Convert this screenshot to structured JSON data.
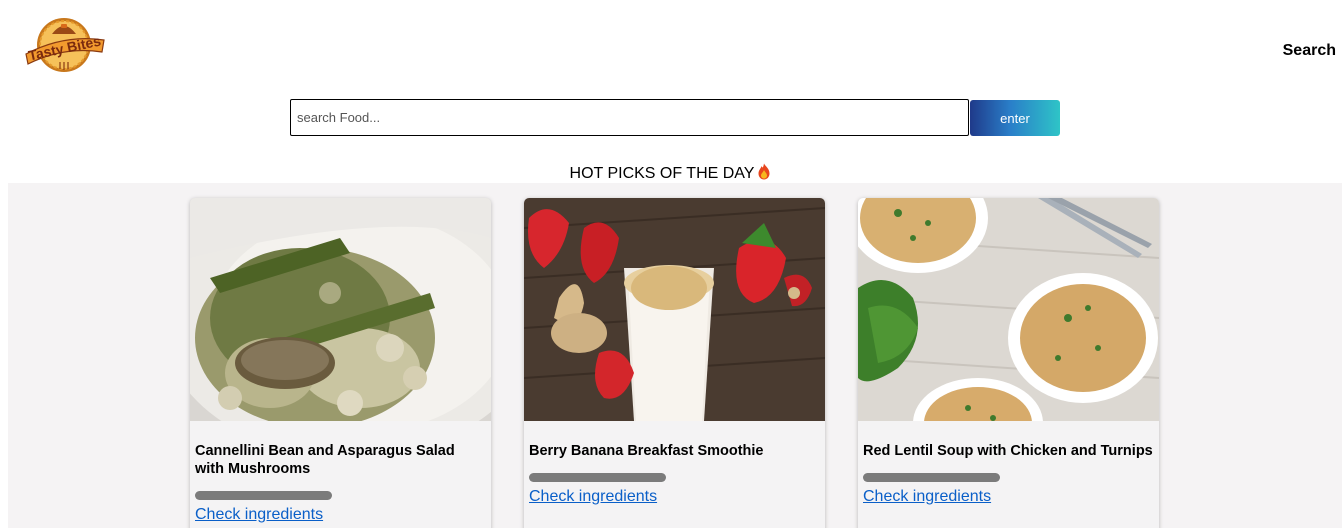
{
  "brand": {
    "logo_text": "Tasty Bites"
  },
  "nav": {
    "search_label": "Search"
  },
  "search": {
    "placeholder": "search Food...",
    "value": "",
    "button_label": "enter"
  },
  "section": {
    "title": "HOT PICKS OF THE DAY",
    "icon": "fire-icon"
  },
  "cards": [
    {
      "title": "Cannellini Bean and Asparagus Salad with Mushrooms",
      "link_label": "Check ingredients",
      "image": "bean-asparagus-salad-photo"
    },
    {
      "title": "Berry Banana Breakfast Smoothie",
      "link_label": "Check ingredients",
      "image": "berry-smoothie-photo"
    },
    {
      "title": "Red Lentil Soup with Chicken and Turnips",
      "link_label": "Check ingredients",
      "image": "lentil-soup-photo"
    }
  ],
  "colors": {
    "accent_gradient": [
      "#1f3a8a",
      "#2ec4c7"
    ],
    "link": "#0a5fc8",
    "content_background": "#f5f3f4"
  }
}
